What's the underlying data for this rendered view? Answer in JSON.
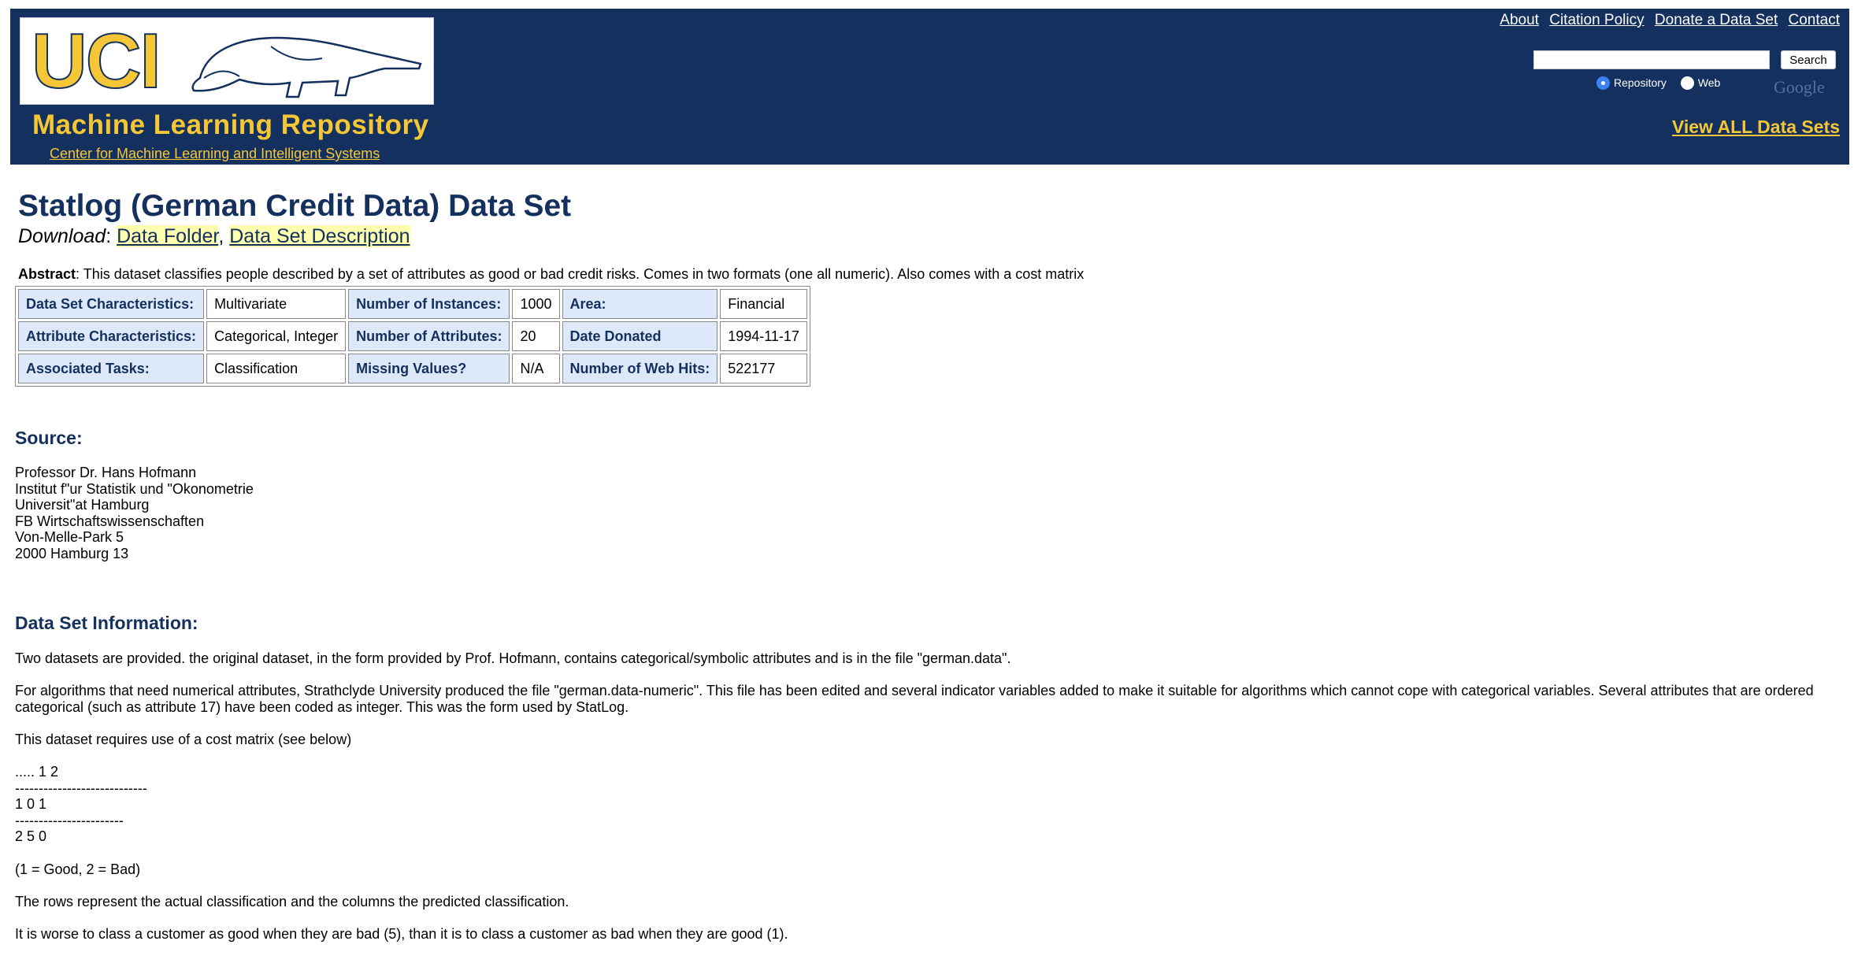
{
  "header": {
    "logo_text": "UCI",
    "repo_title": "Machine Learning Repository",
    "center_link": "Center for Machine Learning and Intelligent Systems",
    "top_links": [
      "About",
      "Citation Policy",
      "Donate a Data Set",
      "Contact"
    ],
    "search": {
      "value": "",
      "button": "Search"
    },
    "radio": [
      {
        "label": "Repository",
        "checked": true
      },
      {
        "label": "Web",
        "checked": false
      }
    ],
    "google": "Google",
    "view_all": "View ALL Data Sets"
  },
  "title": "Statlog (German Credit Data) Data Set",
  "download": {
    "label": "Download",
    "sep": ":",
    "links": [
      "Data Folder",
      "Data Set Description"
    ]
  },
  "abstract": {
    "label": "Abstract",
    "text": ": This dataset classifies people described by a set of attributes as good or bad credit risks. Comes in two formats (one all numeric). Also comes with a cost matrix"
  },
  "characteristics": [
    [
      "Data Set Characteristics:",
      "Multivariate",
      "Number of Instances:",
      "1000",
      "Area:",
      "Financial"
    ],
    [
      "Attribute Characteristics:",
      "Categorical, Integer",
      "Number of Attributes:",
      "20",
      "Date Donated",
      "1994-11-17"
    ],
    [
      "Associated Tasks:",
      "Classification",
      "Missing Values?",
      "N/A",
      "Number of Web Hits:",
      "522177"
    ]
  ],
  "source": {
    "heading": "Source:",
    "lines": [
      "Professor Dr. Hans Hofmann",
      "Institut f\"ur Statistik und \"Okonometrie",
      "Universit\"at Hamburg",
      "FB Wirtschaftswissenschaften",
      "Von-Melle-Park 5",
      "2000 Hamburg 13"
    ]
  },
  "info": {
    "heading": "Data Set Information:",
    "p1": "Two datasets are provided. the original dataset, in the form provided by Prof. Hofmann, contains categorical/symbolic attributes and is in the file \"german.data\".",
    "p2": "For algorithms that need numerical attributes, Strathclyde University produced the file \"german.data-numeric\". This file has been edited and several indicator variables added to make it suitable for algorithms which cannot cope with categorical variables. Several attributes that are ordered categorical (such as attribute 17) have been coded as integer. This was the form used by StatLog.",
    "p3": "This dataset requires use of a cost matrix (see below)",
    "matrix": [
      ".....  1 2",
      "----------------------------",
      "1  0 1",
      "-----------------------",
      "2  5 0"
    ],
    "p4": "(1 = Good, 2 = Bad)",
    "p5": "The rows represent the actual classification and the columns the predicted classification.",
    "p6": "It is worse to class a customer as good when they are bad (5), than it is to class a customer as bad when they are good (1)."
  }
}
